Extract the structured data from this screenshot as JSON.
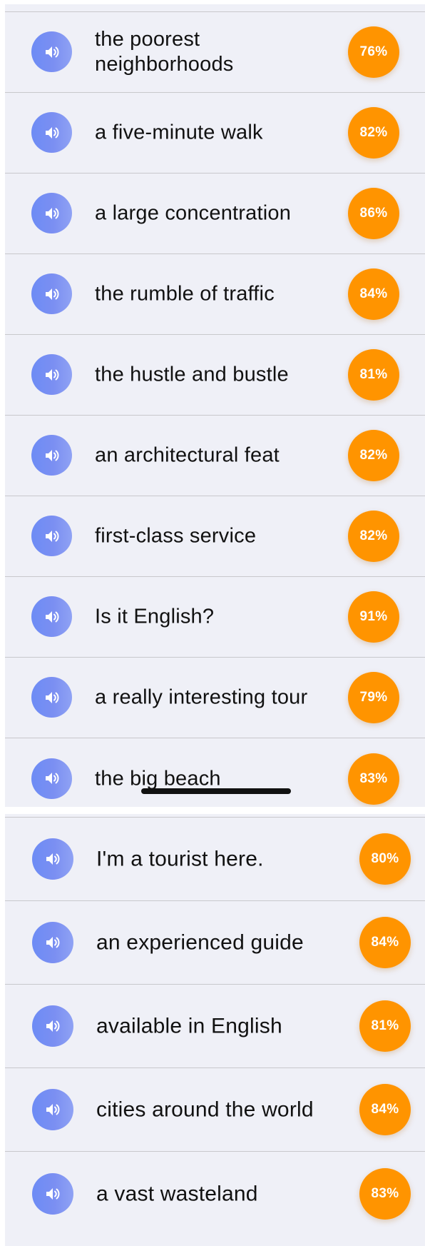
{
  "colors": {
    "panel_background": "#eff0f7",
    "speaker_button_gradient": [
      "#6d8cf5",
      "#8fa2f4"
    ],
    "score_badge": "#ff9400",
    "score_text": "#ffffff",
    "phrase_text": "#111111"
  },
  "icons": {
    "speak": "speaker-volume-icon"
  },
  "panel_top": {
    "rows": [
      {
        "phrase": "the poorest neighborhoods",
        "score": "76%"
      },
      {
        "phrase": "a five-minute walk",
        "score": "82%"
      },
      {
        "phrase": "a large concentration",
        "score": "86%"
      },
      {
        "phrase": "the rumble of traffic",
        "score": "84%"
      },
      {
        "phrase": "the hustle and bustle",
        "score": "81%"
      },
      {
        "phrase": "an architectural feat",
        "score": "82%"
      },
      {
        "phrase": "first-class service",
        "score": "82%"
      },
      {
        "phrase": "Is it English?",
        "score": "91%"
      },
      {
        "phrase": "a really interesting tour",
        "score": "79%"
      },
      {
        "phrase": "the big beach",
        "score": "83%"
      }
    ]
  },
  "panel_bottom": {
    "rows": [
      {
        "phrase": "I'm a tourist here.",
        "score": "80%"
      },
      {
        "phrase": "an experienced guide",
        "score": "84%"
      },
      {
        "phrase": "available in English",
        "score": "81%"
      },
      {
        "phrase": "cities around the world",
        "score": "84%"
      },
      {
        "phrase": "a vast wasteland",
        "score": "83%"
      }
    ]
  }
}
